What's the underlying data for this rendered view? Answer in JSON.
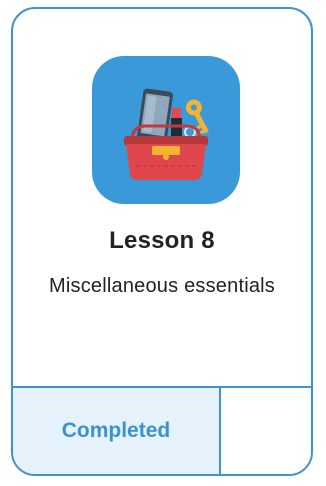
{
  "lesson": {
    "title": "Lesson 8",
    "subtitle": "Miscellaneous essentials",
    "status": "Completed",
    "icon": "bag-with-essentials-icon"
  },
  "colors": {
    "accent": "#3f93d3",
    "tile": "#3a9ad9",
    "status_bg": "#e6f3fc",
    "status_text": "#3a92d6"
  }
}
